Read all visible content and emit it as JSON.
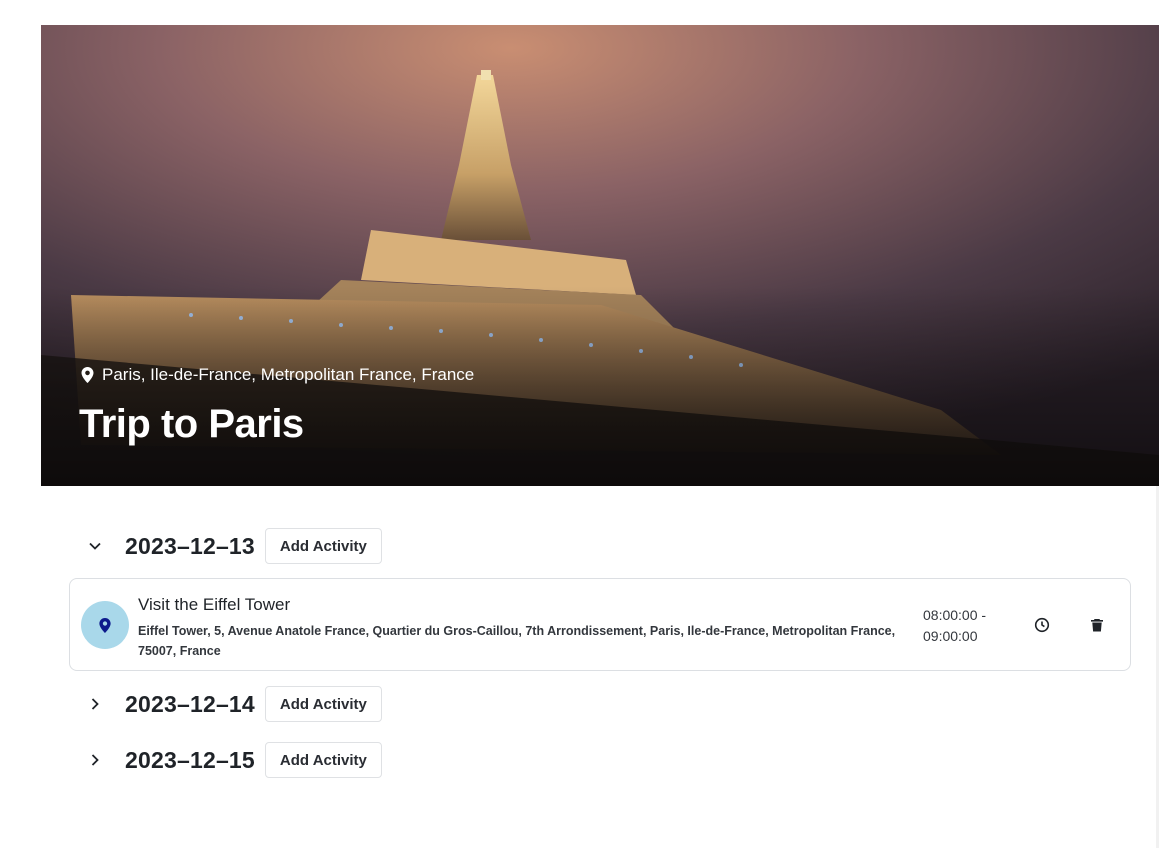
{
  "trip": {
    "location": "Paris, Ile-de-France, Metropolitan France, France",
    "title": "Trip to Paris"
  },
  "days": [
    {
      "date": "2023–12–13",
      "expanded": true,
      "add_label": "Add Activity",
      "activities": [
        {
          "name": "Visit the Eiffel Tower",
          "address": "Eiffel Tower, 5, Avenue Anatole France, Quartier du Gros-Caillou, 7th Arrondissement, Paris, Ile-de-France, Metropolitan France, 75007, France",
          "time_start": "08:00:00 -",
          "time_end": "09:00:00",
          "icon": "map-pin-icon",
          "actions": [
            "clock-icon",
            "trash-icon"
          ]
        }
      ]
    },
    {
      "date": "2023–12–14",
      "expanded": false,
      "add_label": "Add Activity",
      "activities": []
    },
    {
      "date": "2023–12–15",
      "expanded": false,
      "add_label": "Add Activity",
      "activities": []
    }
  ],
  "colors": {
    "pin_bg": "#a9d8ea",
    "pin_icon": "#0d1a8c",
    "border": "#dcdfe3"
  }
}
